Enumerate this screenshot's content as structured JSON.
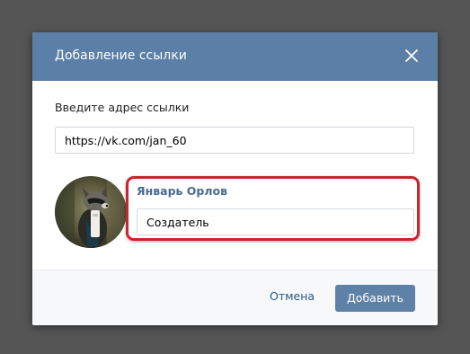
{
  "dialog": {
    "title": "Добавление ссылки",
    "close_icon": "close-icon"
  },
  "link_form": {
    "label": "Введите адрес ссылки",
    "url_value": "https://vk.com/jan_60"
  },
  "member": {
    "name": "Январь Орлов",
    "role_value": "Создатель",
    "avatar_icon": "raccoon-avatar"
  },
  "footer": {
    "cancel_label": "Отмена",
    "submit_label": "Добавить"
  },
  "colors": {
    "header_bg": "#5b7fa6",
    "accent_link": "#2a5885",
    "button_bg": "#5e81a8",
    "highlight_border": "#c4282c",
    "overlay": "#555555"
  }
}
